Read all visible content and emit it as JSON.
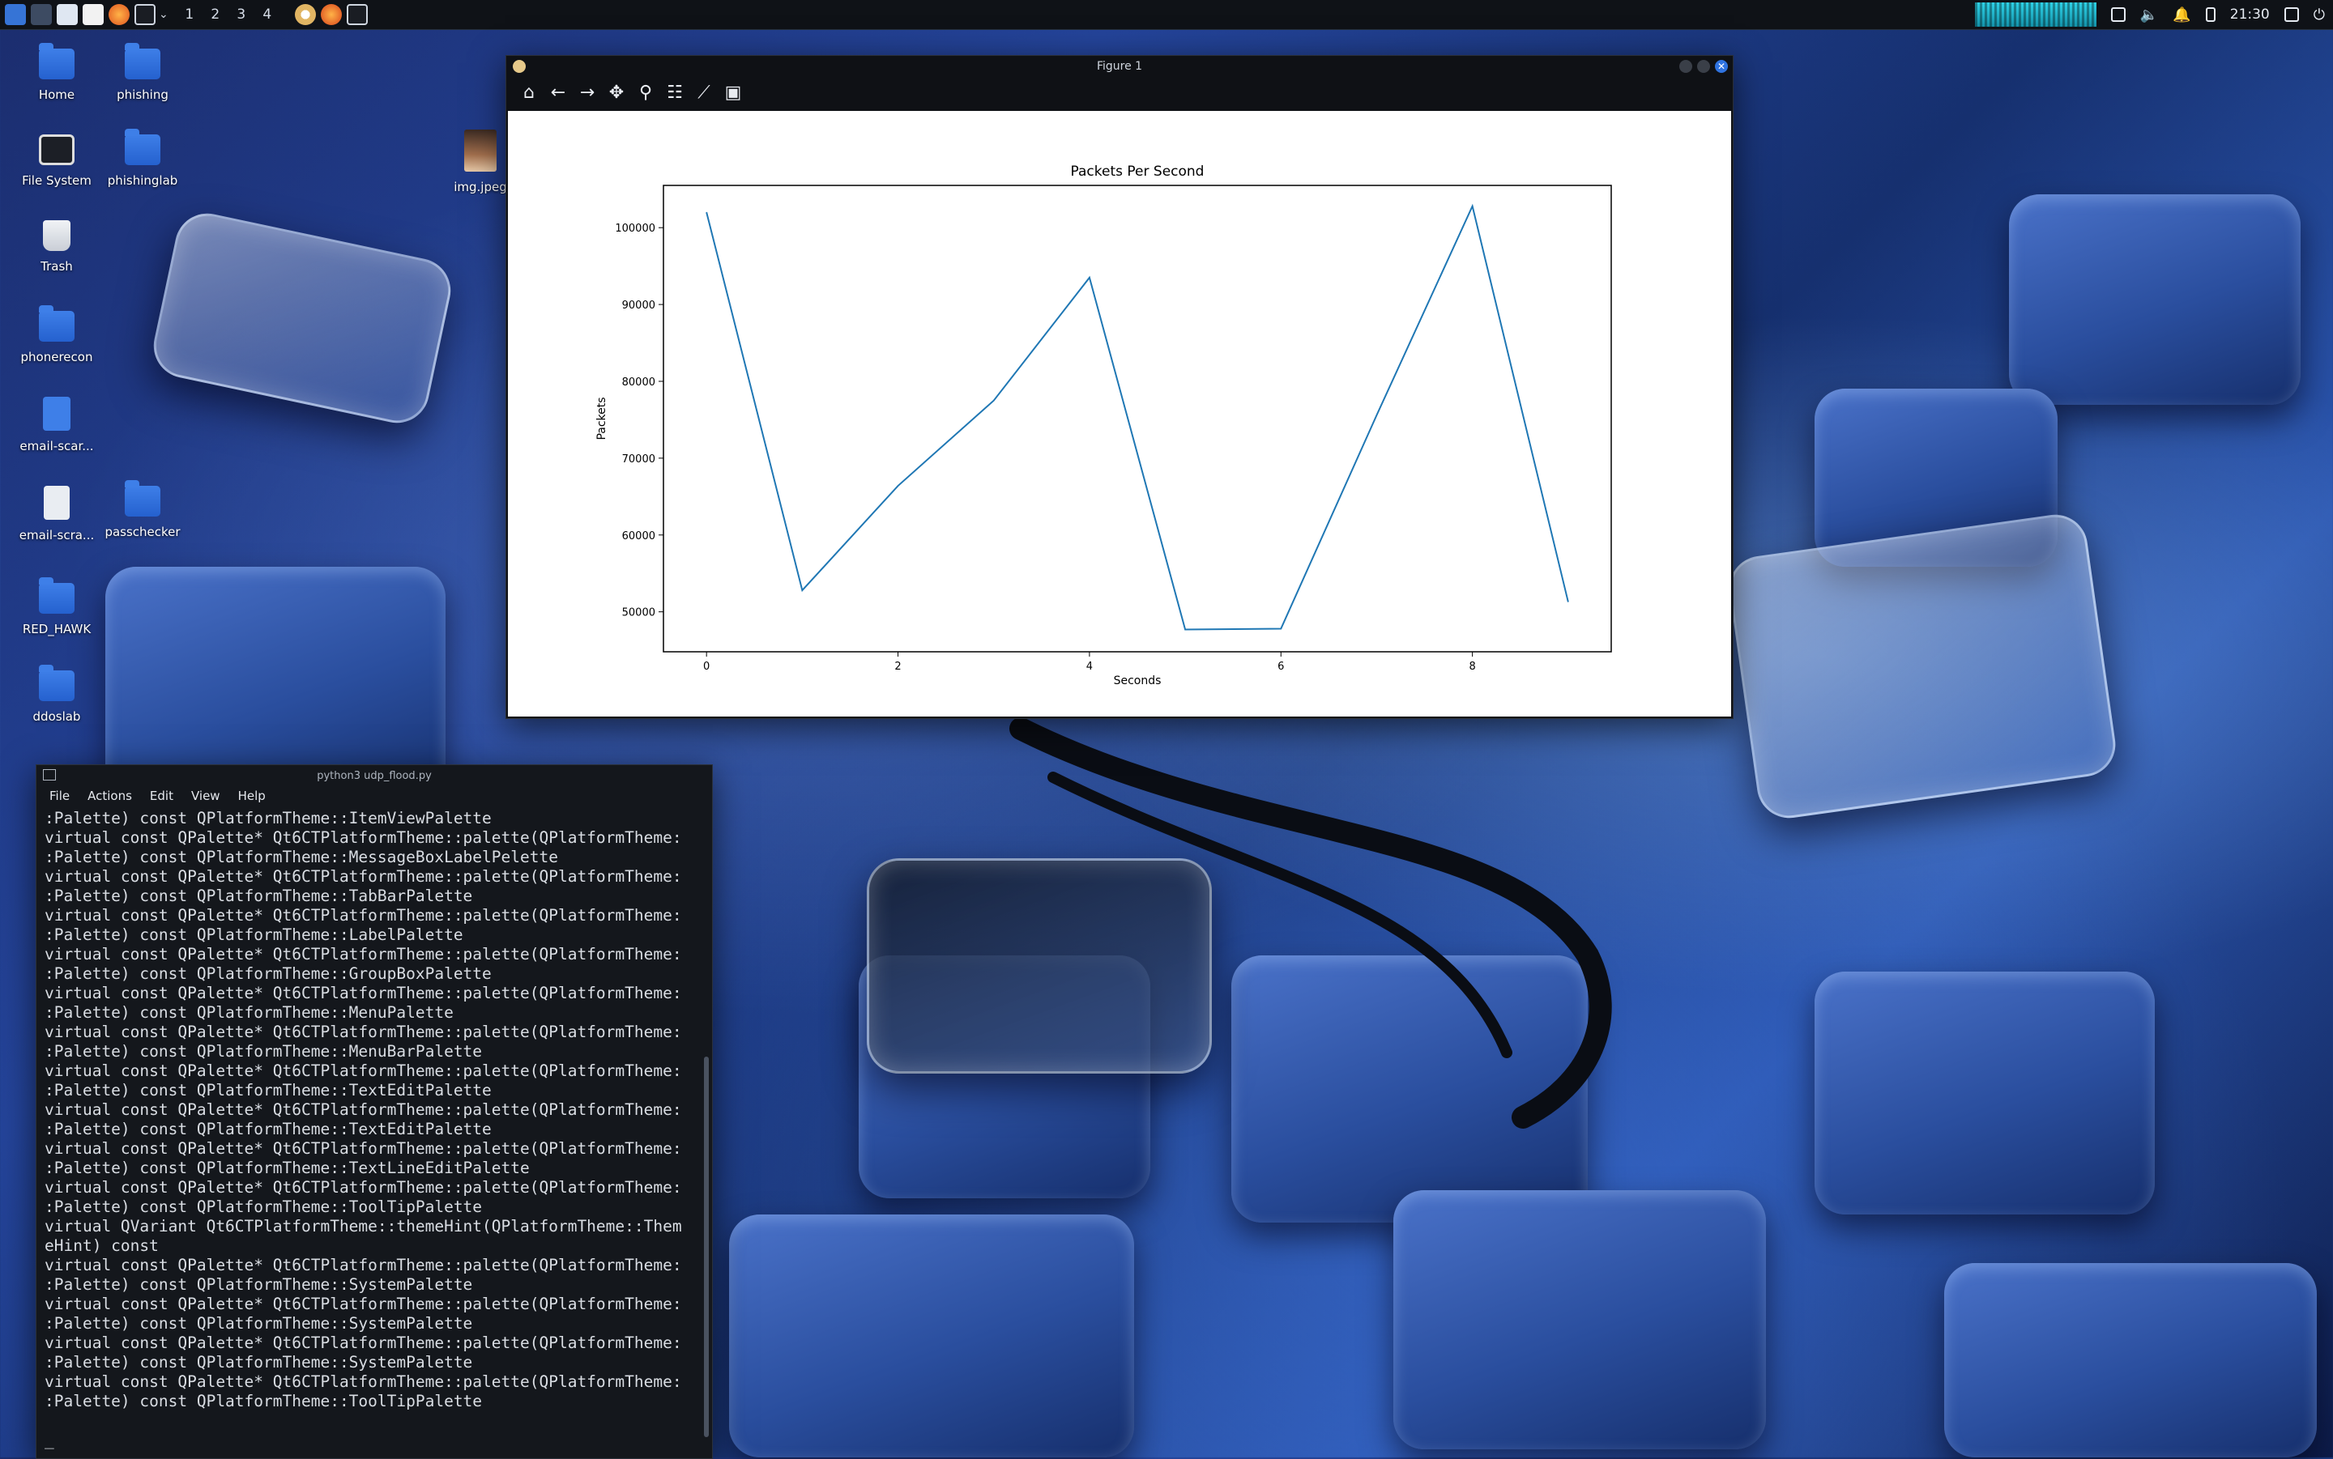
{
  "taskbar": {
    "workspaces": [
      "1",
      "2",
      "3",
      "4"
    ],
    "clock": "21:30"
  },
  "desktop": {
    "icons": [
      {
        "label": "Home",
        "icon": "home-folder-icon"
      },
      {
        "label": "phishing",
        "icon": "folder-icon"
      },
      {
        "label": "File System",
        "icon": "drive-icon"
      },
      {
        "label": "phishinglab",
        "icon": "folder-icon"
      },
      {
        "label": "img.jpeg",
        "icon": "image-icon"
      },
      {
        "label": "Trash",
        "icon": "trash-icon"
      },
      {
        "label": "phonerecon",
        "icon": "folder-icon"
      },
      {
        "label": "email-scar...",
        "icon": "python-file-icon"
      },
      {
        "label": "email-scra...",
        "icon": "text-file-icon"
      },
      {
        "label": "passchecker",
        "icon": "folder-icon"
      },
      {
        "label": "RED_HAWK",
        "icon": "folder-icon"
      },
      {
        "label": "ddoslab",
        "icon": "folder-icon"
      }
    ]
  },
  "figure_window": {
    "title": "Figure 1",
    "toolbar": [
      "home-icon",
      "back-arrow-icon",
      "forward-arrow-icon",
      "pan-icon",
      "zoom-icon",
      "configure-subplots-icon",
      "edit-axis-icon",
      "save-icon"
    ]
  },
  "chart_data": {
    "type": "line",
    "title": "Packets Per Second",
    "xlabel": "Seconds",
    "ylabel": "Packets",
    "x": [
      0,
      1,
      2,
      3,
      4,
      5,
      6,
      7,
      8,
      9
    ],
    "series": [
      {
        "values": [
          102000,
          52800,
          66400,
          77500,
          93500,
          47700,
          47800,
          75600,
          102800,
          51300
        ]
      }
    ],
    "xlim": [
      -0.45,
      9.45
    ],
    "ylim": [
      44800,
      105500
    ],
    "xticks": [
      "0",
      "2",
      "4",
      "6",
      "8"
    ],
    "yticks": [
      "50000",
      "60000",
      "70000",
      "80000",
      "90000",
      "100000"
    ],
    "line_color": "#1f77b4",
    "grid": false
  },
  "terminal": {
    "title": "python3 udp_flood.py",
    "menu": [
      "File",
      "Actions",
      "Edit",
      "View",
      "Help"
    ],
    "lines": [
      ":Palette) const QPlatformTheme::ItemViewPalette",
      "virtual const QPalette* Qt6CTPlatformTheme::palette(QPlatformTheme:",
      ":Palette) const QPlatformTheme::MessageBoxLabelPelette",
      "virtual const QPalette* Qt6CTPlatformTheme::palette(QPlatformTheme:",
      ":Palette) const QPlatformTheme::TabBarPalette",
      "virtual const QPalette* Qt6CTPlatformTheme::palette(QPlatformTheme:",
      ":Palette) const QPlatformTheme::LabelPalette",
      "virtual const QPalette* Qt6CTPlatformTheme::palette(QPlatformTheme:",
      ":Palette) const QPlatformTheme::GroupBoxPalette",
      "virtual const QPalette* Qt6CTPlatformTheme::palette(QPlatformTheme:",
      ":Palette) const QPlatformTheme::MenuPalette",
      "virtual const QPalette* Qt6CTPlatformTheme::palette(QPlatformTheme:",
      ":Palette) const QPlatformTheme::MenuBarPalette",
      "virtual const QPalette* Qt6CTPlatformTheme::palette(QPlatformTheme:",
      ":Palette) const QPlatformTheme::TextEditPalette",
      "virtual const QPalette* Qt6CTPlatformTheme::palette(QPlatformTheme:",
      ":Palette) const QPlatformTheme::TextEditPalette",
      "virtual const QPalette* Qt6CTPlatformTheme::palette(QPlatformTheme:",
      ":Palette) const QPlatformTheme::TextLineEditPalette",
      "virtual const QPalette* Qt6CTPlatformTheme::palette(QPlatformTheme:",
      ":Palette) const QPlatformTheme::ToolTipPalette",
      "virtual QVariant Qt6CTPlatformTheme::themeHint(QPlatformTheme::Them",
      "eHint) const",
      "virtual const QPalette* Qt6CTPlatformTheme::palette(QPlatformTheme:",
      ":Palette) const QPlatformTheme::SystemPalette",
      "virtual const QPalette* Qt6CTPlatformTheme::palette(QPlatformTheme:",
      ":Palette) const QPlatformTheme::SystemPalette",
      "virtual const QPalette* Qt6CTPlatformTheme::palette(QPlatformTheme:",
      ":Palette) const QPlatformTheme::SystemPalette",
      "virtual const QPalette* Qt6CTPlatformTheme::palette(QPlatformTheme:",
      ":Palette) const QPlatformTheme::ToolTipPalette",
      "",
      "_"
    ]
  }
}
